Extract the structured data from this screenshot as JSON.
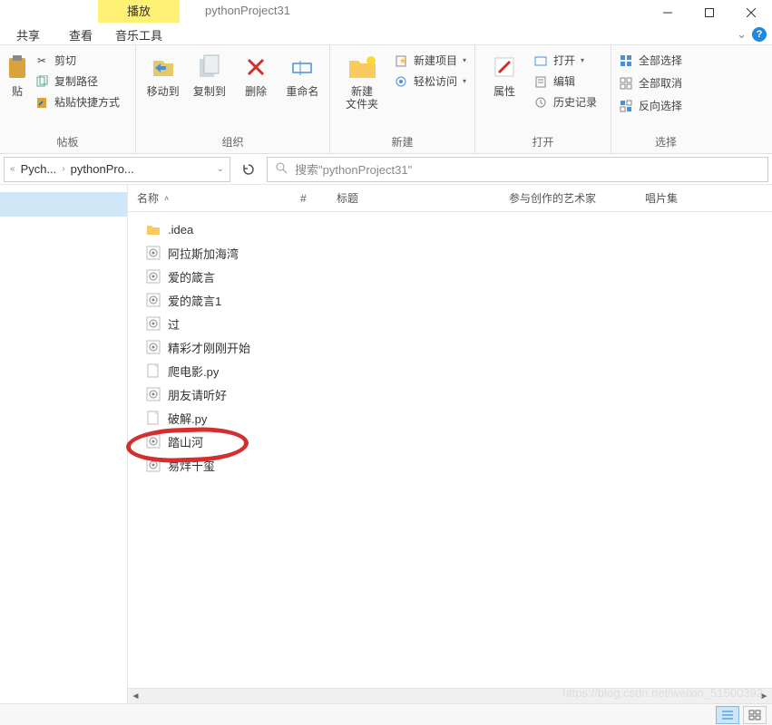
{
  "window": {
    "play_tab": "播放",
    "title": "pythonProject31",
    "menu": {
      "share": "共享",
      "view": "查看",
      "music_tool": "音乐工具"
    }
  },
  "ribbon": {
    "clipboard": {
      "cut": "剪切",
      "copy_path": "复制路径",
      "paste_shortcut": "粘贴快捷方式",
      "paste": "粘贴",
      "label_cn": "贴",
      "panel": "帖板",
      "group": "帖板"
    },
    "organize": {
      "move_to": "移动到",
      "copy_to": "复制到",
      "delete": "删除",
      "rename": "重命名",
      "group": "组织"
    },
    "new": {
      "new_folder": "新建\n文件夹",
      "new_item": "新建项目",
      "easy_access": "轻松访问",
      "group": "新建"
    },
    "open": {
      "properties": "属性",
      "open": "打开",
      "edit": "编辑",
      "history": "历史记录",
      "group": "打开"
    },
    "select": {
      "select_all": "全部选择",
      "select_none": "全部取消",
      "invert": "反向选择",
      "group": "选择"
    }
  },
  "nav": {
    "bc1": "Pych...",
    "bc2": "pythonPro...",
    "search_placeholder": "搜索\"pythonProject31\""
  },
  "columns": {
    "name": "名称",
    "num": "#",
    "title": "标题",
    "artist": "参与创作的艺术家",
    "album": "唱片集"
  },
  "files": [
    {
      "name": ".idea",
      "type": "folder"
    },
    {
      "name": "阿拉斯加海湾",
      "type": "audio"
    },
    {
      "name": "爱的箴言",
      "type": "audio"
    },
    {
      "name": "爱的箴言1",
      "type": "audio"
    },
    {
      "name": "过",
      "type": "audio"
    },
    {
      "name": "精彩才刚刚开始",
      "type": "audio"
    },
    {
      "name": "爬电影.py",
      "type": "py"
    },
    {
      "name": "朋友请听好",
      "type": "audio"
    },
    {
      "name": "破解.py",
      "type": "py"
    },
    {
      "name": "踏山河",
      "type": "audio"
    },
    {
      "name": "易烊千玺",
      "type": "audio"
    }
  ],
  "highlighted_file": "踏山河",
  "watermark": "https://blog.csdn.net/weixin_51500392"
}
